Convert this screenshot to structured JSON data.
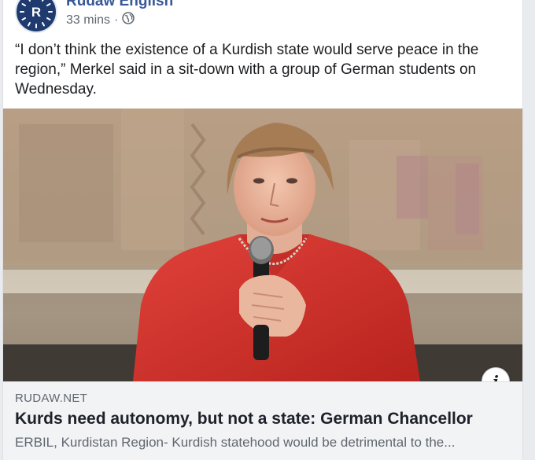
{
  "post": {
    "page_name": "Rudaw English",
    "avatar_letter": "R",
    "timestamp": "33 mins",
    "separator": "·",
    "privacy_icon": "globe-icon",
    "text": "“I don’t think the existence of a Kurdish state would serve peace in the region,” Merkel said in a sit-down with a group of German students on Wednesday."
  },
  "link_preview": {
    "image_description_icon": "photo",
    "info_icon": "info-icon",
    "info_glyph": "i",
    "domain": "RUDAW.NET",
    "title": "Kurds need autonomy, but not a state: German Chancellor",
    "description": "ERBIL, Kurdistan Region- Kurdish statehood would be detrimental to the..."
  },
  "colors": {
    "page_name": "#385898",
    "jacket": "#d9332b",
    "link_bg": "#f2f3f5",
    "avatar_bg": "#1e3a6e"
  }
}
